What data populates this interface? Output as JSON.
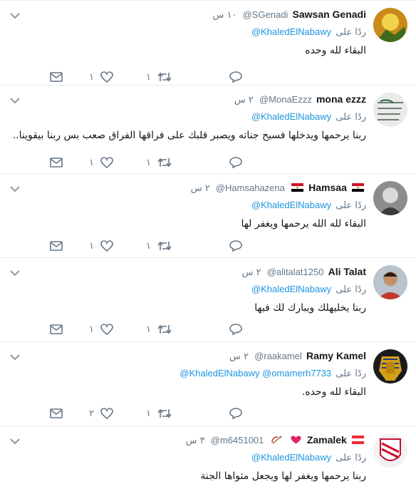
{
  "tweets": [
    {
      "name": "Sawsan Genadi",
      "handle": "@SGenadi",
      "time": "١٠ س",
      "reply_prefix": "ردًا على",
      "mentions": "@KhaledElNabawy",
      "text": "البقاء لله وحده",
      "replies": "",
      "retweets": "١",
      "likes": "١"
    },
    {
      "name": "mona ezzz",
      "handle": "@MonaEzzz",
      "time": "٢ س",
      "reply_prefix": "ردًا على",
      "mentions": "@KhaledElNabawy",
      "text": "ربنا يرحمها ويدخلها فسيح جناته ويصبر قلبك على فراقها الفراق صعب بس ربنا بيقوينا..",
      "replies": "",
      "retweets": "١",
      "likes": "١"
    },
    {
      "name": "Hamsaa",
      "handle": "@Hamsahazena",
      "time": "٢ س",
      "reply_prefix": "ردًا على",
      "mentions": "@KhaledElNabawy",
      "text": "البقاء لله الله يرحمها ويغفر لها",
      "replies": "",
      "retweets": "١",
      "likes": "١"
    },
    {
      "name": "Ali Talat",
      "handle": "@alitalat1250",
      "time": "٢ س",
      "reply_prefix": "ردًا على",
      "mentions": "@KhaledElNabawy",
      "text": "ربنا يخليهلك ويبارك لك فيها",
      "replies": "",
      "retweets": "١",
      "likes": "١"
    },
    {
      "name": "Ramy Kamel",
      "handle": "@raakamel",
      "time": "٢ س",
      "reply_prefix": "ردًا على",
      "mentions": "@KhaledElNabawy @omamerh7733",
      "text": "البقاء لله وحده.",
      "replies": "",
      "retweets": "١",
      "likes": "٢"
    },
    {
      "name": "Zamalek",
      "handle": "@m6451001",
      "time": "٣ س",
      "reply_prefix": "ردًا على",
      "mentions": "@KhaledElNabawy",
      "text": "ربنا يرحمها ويغفر لها ويجعل مثواها الجنة",
      "replies": "",
      "retweets": "",
      "likes": ""
    }
  ],
  "colors": {
    "link": "#1b95e0",
    "secondary": "#657786",
    "divider": "#e6ecf0"
  },
  "icons": {
    "reply": "speech-bubble-icon",
    "retweet": "retweet-arrows-icon",
    "like": "heart-outline-icon",
    "dm": "envelope-icon",
    "menu": "chevron-down-icon",
    "flag": "egypt-flag-icon",
    "heart": "red-heart-emoji-icon",
    "cupid": "bow-arrow-emoji-icon"
  }
}
